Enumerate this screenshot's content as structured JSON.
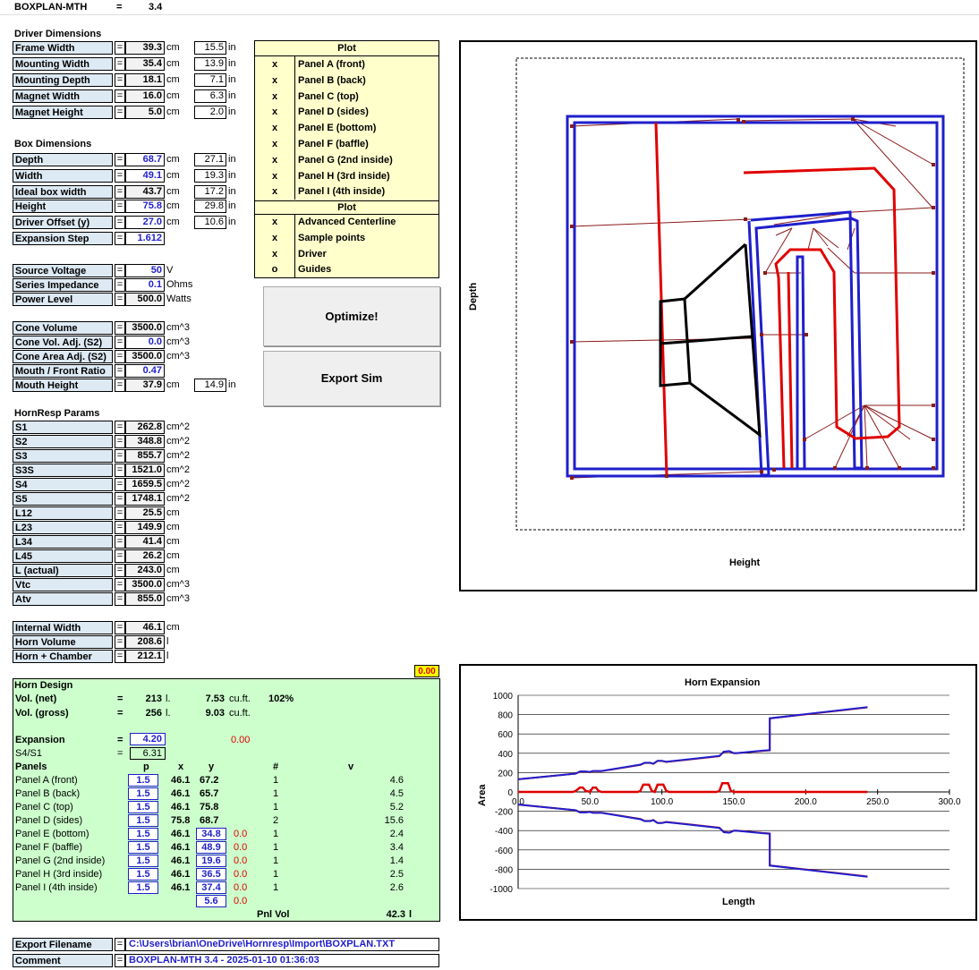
{
  "header": {
    "name": "BOXPLAN-MTH",
    "eq": "=",
    "version": "3.4"
  },
  "driver": {
    "title": "Driver Dimensions",
    "rows": [
      {
        "label": "Frame Width",
        "value": "39.3",
        "unit": "cm",
        "inches": "15.5",
        "in": "in"
      },
      {
        "label": "Mounting Width",
        "value": "35.4",
        "unit": "cm",
        "inches": "13.9",
        "in": "in"
      },
      {
        "label": "Mounting Depth",
        "value": "18.1",
        "unit": "cm",
        "inches": "7.1",
        "in": "in"
      },
      {
        "label": "Magnet Width",
        "value": "16.0",
        "unit": "cm",
        "inches": "6.3",
        "in": "in"
      },
      {
        "label": "Magnet Height",
        "value": "5.0",
        "unit": "cm",
        "inches": "2.0",
        "in": "in"
      }
    ]
  },
  "box": {
    "title": "Box Dimensions",
    "rows": [
      {
        "label": "Depth",
        "value": "68.7",
        "unit": "cm",
        "inches": "27.1",
        "in": "in"
      },
      {
        "label": "Width",
        "value": "49.1",
        "unit": "cm",
        "inches": "19.3",
        "in": "in"
      },
      {
        "label": "Ideal box width",
        "value": "43.7",
        "unit": "cm",
        "inches": "17.2",
        "in": "in"
      },
      {
        "label": "Height",
        "value": "75.8",
        "unit": "cm",
        "inches": "29.8",
        "in": "in"
      },
      {
        "label": "Driver Offset (y)",
        "value": "27.0",
        "unit": "cm",
        "inches": "10.6",
        "in": "in"
      },
      {
        "label": "Expansion Step",
        "value": "1.612",
        "unit": "",
        "inches": "",
        "in": ""
      }
    ]
  },
  "power": {
    "rows": [
      {
        "label": "Source Voltage",
        "value": "50",
        "unit": "V"
      },
      {
        "label": "Series Impedance",
        "value": "0.1",
        "unit": "Ohms"
      },
      {
        "label": "Power Level",
        "value": "500.0",
        "unit": "Watts"
      }
    ]
  },
  "cone": {
    "rows": [
      {
        "label": "Cone Volume",
        "value": "3500.0",
        "unit": "cm^3"
      },
      {
        "label": "Cone Vol. Adj. (S2)",
        "value": "0.0",
        "unit": "cm^3"
      },
      {
        "label": "Cone Area Adj. (S2)",
        "value": "3500.0",
        "unit": "cm^3"
      },
      {
        "label": "Mouth / Front Ratio",
        "value": "0.47",
        "unit": ""
      },
      {
        "label": "Mouth Height",
        "value": "37.9",
        "unit": "cm",
        "inches": "14.9",
        "in": "in"
      }
    ]
  },
  "hornresp": {
    "title": "HornResp Params",
    "rows": [
      {
        "label": "S1",
        "value": "262.8",
        "unit": "cm^2"
      },
      {
        "label": "S2",
        "value": "348.8",
        "unit": "cm^2"
      },
      {
        "label": "S3",
        "value": "855.7",
        "unit": "cm^2"
      },
      {
        "label": "S3S",
        "value": "1521.0",
        "unit": "cm^2"
      },
      {
        "label": "S4",
        "value": "1659.5",
        "unit": "cm^2"
      },
      {
        "label": "S5",
        "value": "1748.1",
        "unit": "cm^2"
      },
      {
        "label": "L12",
        "value": "25.5",
        "unit": "cm"
      },
      {
        "label": "L23",
        "value": "149.9",
        "unit": "cm"
      },
      {
        "label": "L34",
        "value": "41.4",
        "unit": "cm"
      },
      {
        "label": "L45",
        "value": "26.2",
        "unit": "cm"
      },
      {
        "label": "L (actual)",
        "value": "243.0",
        "unit": "cm"
      },
      {
        "label": "Vtc",
        "value": "3500.0",
        "unit": "cm^3"
      },
      {
        "label": "Atv",
        "value": "855.0",
        "unit": "cm^3"
      }
    ]
  },
  "internal": {
    "rows": [
      {
        "label": "Internal Width",
        "value": "46.1",
        "unit": "cm"
      },
      {
        "label": "Horn Volume",
        "value": "208.6",
        "unit": "l"
      },
      {
        "label": "Horn + Chamber",
        "value": "212.1",
        "unit": "l"
      }
    ]
  },
  "warning_value": "0.00",
  "plot_panel": {
    "header1": "Plot",
    "items1": [
      {
        "mark": "x",
        "label": "Panel A (front)"
      },
      {
        "mark": "x",
        "label": "Panel B (back)"
      },
      {
        "mark": "x",
        "label": "Panel C (top)"
      },
      {
        "mark": "x",
        "label": "Panel D (sides)"
      },
      {
        "mark": "x",
        "label": "Panel E (bottom)"
      },
      {
        "mark": "x",
        "label": "Panel F (baffle)"
      },
      {
        "mark": "x",
        "label": "Panel G (2nd inside)"
      },
      {
        "mark": "x",
        "label": "Panel H (3rd inside)"
      },
      {
        "mark": "x",
        "label": "Panel I (4th inside)"
      }
    ],
    "header2": "Plot",
    "items2": [
      {
        "mark": "x",
        "label": "Advanced Centerline"
      },
      {
        "mark": "x",
        "label": "Sample points"
      },
      {
        "mark": "x",
        "label": "Driver"
      },
      {
        "mark": "o",
        "label": "Guides"
      }
    ]
  },
  "buttons": {
    "optimize": "Optimize!",
    "export": "Export Sim"
  },
  "horn_design": {
    "title": "Horn Design",
    "vol_net_label": "Vol. (net)",
    "vol_net_l": "213",
    "vol_net_lu": "l.",
    "vol_net_cuft": "7.53",
    "vol_net_cuftu": "cu.ft.",
    "vol_net_pct": "102%",
    "vol_gross_label": "Vol. (gross)",
    "vol_gross_l": "256",
    "vol_gross_lu": "l.",
    "vol_gross_cuft": "9.03",
    "vol_gross_cuftu": "cu.ft.",
    "eq": "=",
    "expansion_label": "Expansion",
    "expansion": "4.20",
    "expansion_red": "0.00",
    "s4s1_label": "S4/S1",
    "s4s1": "6.31",
    "col_panels": "Panels",
    "col_p": "p",
    "col_x": "x",
    "col_y": "y",
    "col_n": "#",
    "col_v": "v",
    "panels": [
      {
        "name": "Panel A (front)",
        "p": "1.5",
        "x": "46.1",
        "y": "67.2",
        "r": "",
        "n": "1",
        "v": "4.6",
        "yb": false
      },
      {
        "name": "Panel B (back)",
        "p": "1.5",
        "x": "46.1",
        "y": "65.7",
        "r": "",
        "n": "1",
        "v": "4.5",
        "yb": false
      },
      {
        "name": "Panel C (top)",
        "p": "1.5",
        "x": "46.1",
        "y": "75.8",
        "r": "",
        "n": "1",
        "v": "5.2",
        "yb": false
      },
      {
        "name": "Panel D (sides)",
        "p": "1.5",
        "x": "75.8",
        "y": "68.7",
        "r": "",
        "n": "2",
        "v": "15.6",
        "yb": false
      },
      {
        "name": "Panel E (bottom)",
        "p": "1.5",
        "x": "46.1",
        "y": "34.8",
        "r": "0.0",
        "n": "1",
        "v": "2.4",
        "yb": true
      },
      {
        "name": "Panel F (baffle)",
        "p": "1.5",
        "x": "46.1",
        "y": "48.9",
        "r": "0.0",
        "n": "1",
        "v": "3.4",
        "yb": true
      },
      {
        "name": "Panel G (2nd inside)",
        "p": "1.5",
        "x": "46.1",
        "y": "19.6",
        "r": "0.0",
        "n": "1",
        "v": "1.4",
        "yb": true
      },
      {
        "name": "Panel H (3rd inside)",
        "p": "1.5",
        "x": "46.1",
        "y": "36.5",
        "r": "0.0",
        "n": "1",
        "v": "2.5",
        "yb": true
      },
      {
        "name": "Panel I (4th inside)",
        "p": "1.5",
        "x": "46.1",
        "y": "37.4",
        "r": "0.0",
        "n": "1",
        "v": "2.6",
        "yb": true
      }
    ],
    "extra_y": "5.6",
    "extra_r": "0.0",
    "pnl_vol_label": "Pnl Vol",
    "pnl_vol": "42.3",
    "pnl_vol_u": "l"
  },
  "export": {
    "filename_label": "Export Filename",
    "eq": "=",
    "filename": "C:\\Users\\brian\\OneDrive\\Hornresp\\Import\\BOXPLAN.TXT",
    "comment_label": "Comment",
    "comment": "BOXPLAN-MTH 3.4 - 2025-01-10 01:36:03"
  },
  "layout_chart": {
    "xlabel": "Height",
    "ylabel": "Depth"
  },
  "chart_data": {
    "type": "line",
    "title": "Horn Expansion",
    "xlabel": "Length",
    "ylabel": "Area",
    "xlim": [
      0,
      300
    ],
    "ylim": [
      -1000,
      1000
    ],
    "xticks": [
      "0.0",
      "50.0",
      "100.0",
      "150.0",
      "200.0",
      "250.0",
      "300.0"
    ],
    "yticks": [
      "1000",
      "800",
      "600",
      "400",
      "200",
      "0",
      "-200",
      "-400",
      "-600",
      "-800",
      "-1000"
    ],
    "grid": true,
    "series": [
      {
        "color": "#e00000",
        "x": [
          0,
          40,
          43,
          47,
          50,
          52,
          56,
          58,
          85,
          88,
          92,
          94,
          97,
          100,
          103,
          140,
          143,
          147,
          150,
          152,
          170,
          175,
          175,
          243
        ],
        "y": [
          131,
          190,
          210,
          210,
          205,
          215,
          215,
          215,
          280,
          300,
          300,
          290,
          320,
          320,
          310,
          370,
          415,
          420,
          400,
          400,
          425,
          430,
          760,
          875
        ]
      },
      {
        "color": "#1f1fcc",
        "x": [
          0,
          40,
          43,
          47,
          50,
          52,
          56,
          58,
          85,
          88,
          92,
          94,
          97,
          100,
          103,
          140,
          143,
          147,
          150,
          152,
          170,
          175,
          175,
          243
        ],
        "y": [
          131,
          190,
          212,
          212,
          207,
          217,
          217,
          217,
          282,
          302,
          302,
          292,
          322,
          322,
          312,
          372,
          417,
          422,
          402,
          402,
          427,
          432,
          762,
          877
        ]
      },
      {
        "color": "#e00000",
        "x": [
          0,
          38,
          40,
          43,
          45,
          47,
          50,
          52,
          54,
          56,
          58,
          60,
          83,
          85,
          87,
          91,
          93,
          95,
          97,
          99,
          101,
          103,
          105,
          138,
          140,
          142,
          146,
          148,
          150,
          152,
          243
        ],
        "y": [
          0,
          0,
          10,
          45,
          45,
          10,
          0,
          45,
          45,
          10,
          0,
          0,
          0,
          10,
          75,
          75,
          10,
          0,
          75,
          75,
          75,
          10,
          0,
          0,
          10,
          90,
          90,
          10,
          0,
          0,
          0
        ]
      },
      {
        "color": "#e00000",
        "x": [
          0,
          40,
          43,
          47,
          50,
          52,
          56,
          58,
          85,
          88,
          92,
          94,
          97,
          100,
          103,
          140,
          143,
          147,
          150,
          152,
          170,
          175,
          175,
          243
        ],
        "y": [
          -131,
          -190,
          -210,
          -210,
          -205,
          -215,
          -215,
          -215,
          -280,
          -300,
          -300,
          -290,
          -320,
          -320,
          -310,
          -370,
          -415,
          -420,
          -400,
          -400,
          -425,
          -430,
          -760,
          -875
        ]
      },
      {
        "color": "#1f1fcc",
        "x": [
          0,
          40,
          43,
          47,
          50,
          52,
          56,
          58,
          85,
          88,
          92,
          94,
          97,
          100,
          103,
          140,
          143,
          147,
          150,
          152,
          170,
          175,
          175,
          243
        ],
        "y": [
          -131,
          -190,
          -212,
          -212,
          -207,
          -217,
          -217,
          -217,
          -282,
          -302,
          -302,
          -292,
          -322,
          -322,
          -312,
          -372,
          -417,
          -422,
          -402,
          -402,
          -427,
          -432,
          -762,
          -877
        ]
      }
    ]
  }
}
